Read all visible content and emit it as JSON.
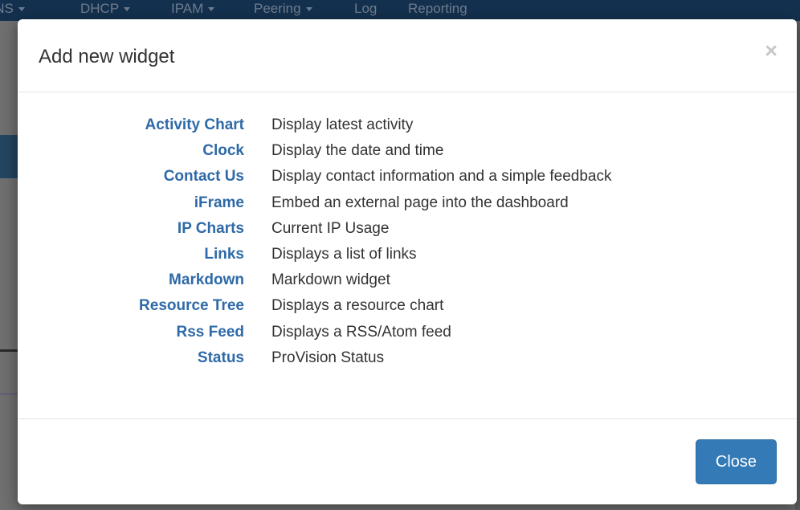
{
  "background": {
    "nav_items": [
      {
        "label": "DNS",
        "has_caret": true
      },
      {
        "label": "DHCP",
        "has_caret": true
      },
      {
        "label": "IPAM",
        "has_caret": true
      },
      {
        "label": "Peering",
        "has_caret": true
      },
      {
        "label": "Log",
        "has_caret": false
      },
      {
        "label": "Reporting",
        "has_caret": false
      }
    ]
  },
  "modal": {
    "title": "Add new widget",
    "close_icon": "×",
    "widgets": [
      {
        "name": "Activity Chart",
        "description": "Display latest activity"
      },
      {
        "name": "Clock",
        "description": "Display the date and time"
      },
      {
        "name": "Contact Us",
        "description": "Display contact information and a simple feedback"
      },
      {
        "name": "iFrame",
        "description": "Embed an external page into the dashboard"
      },
      {
        "name": "IP Charts",
        "description": "Current IP Usage"
      },
      {
        "name": "Links",
        "description": "Displays a list of links"
      },
      {
        "name": "Markdown",
        "description": "Markdown widget"
      },
      {
        "name": "Resource Tree",
        "description": "Displays a resource chart"
      },
      {
        "name": "Rss Feed",
        "description": "Displays a RSS/Atom feed"
      },
      {
        "name": "Status",
        "description": "ProVision Status"
      }
    ],
    "footer": {
      "close_label": "Close"
    }
  },
  "colors": {
    "link": "#2f6aa8",
    "primary_button": "#337ab7",
    "navbar": "#13314f",
    "backdrop": "#6f6f6f"
  }
}
